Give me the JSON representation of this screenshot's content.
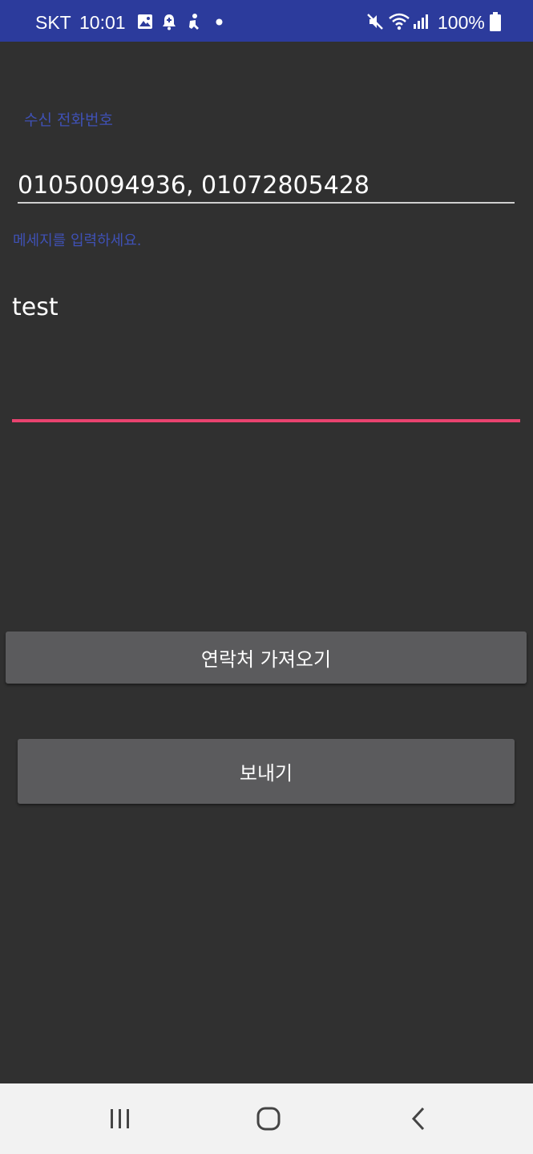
{
  "status_bar": {
    "carrier": "SKT",
    "time": "10:01",
    "battery": "100%",
    "icons": [
      "gallery-icon",
      "notification-bell-icon",
      "accessibility-icon",
      "dot-icon",
      "mute-icon",
      "wifi-icon",
      "signal-icon",
      "battery-icon"
    ],
    "background_color": "#2c3b9c"
  },
  "form": {
    "recipient_label": "수신 전화번호",
    "recipient_value": "01050094936, 01072805428",
    "message_label": "메세지를 입력하세요.",
    "message_value": "test",
    "label_color": "#3f51b5",
    "focus_color": "#e8436f"
  },
  "buttons": {
    "contacts_label": "연락처 가져오기",
    "send_label": "보내기"
  },
  "nav_bar": {
    "items": [
      "recent-apps-icon",
      "home-icon",
      "back-icon"
    ]
  }
}
